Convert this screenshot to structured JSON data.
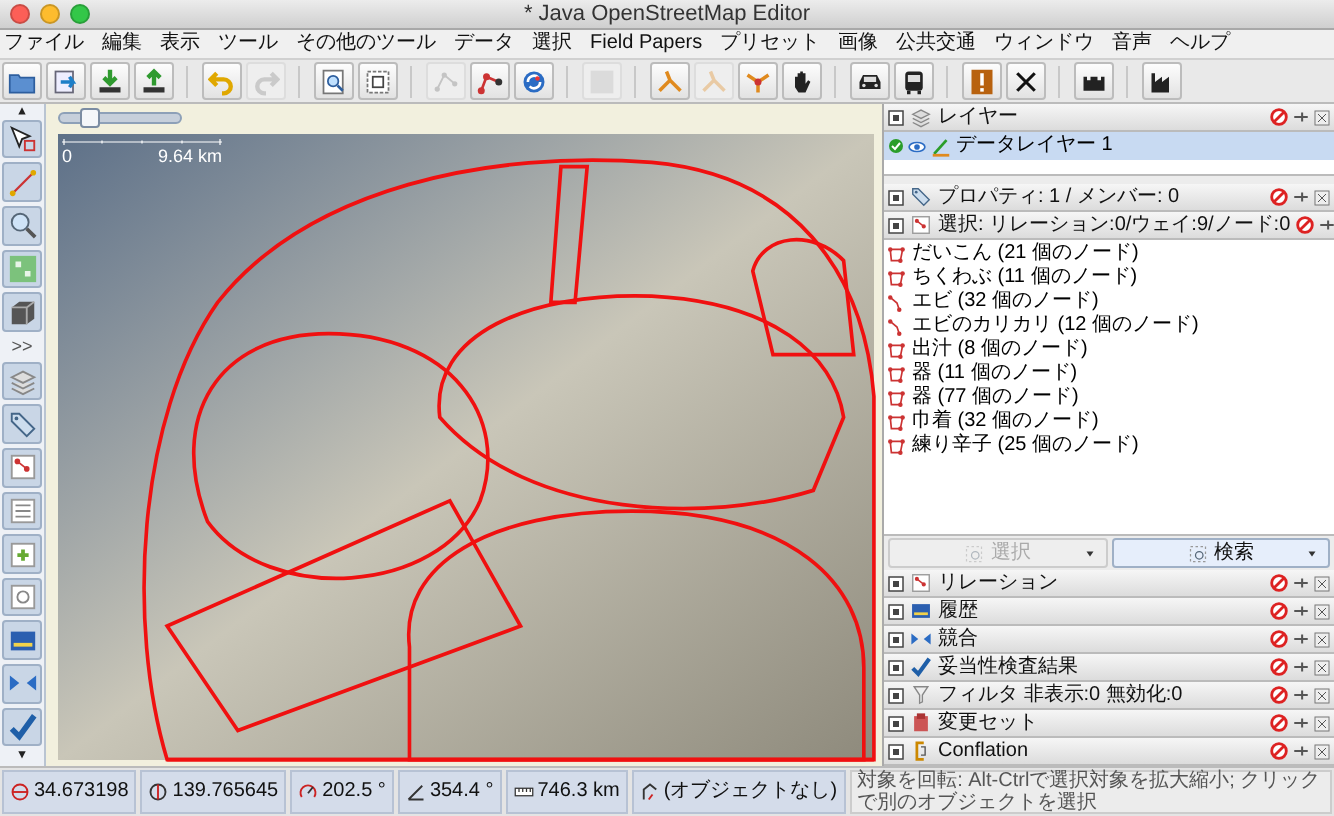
{
  "window": {
    "title": "* Java OpenStreetMap Editor"
  },
  "menu": [
    "ファイル",
    "編集",
    "表示",
    "ツール",
    "その他のツール",
    "データ",
    "選択",
    "Field Papers",
    "プリセット",
    "画像",
    "公共交通",
    "ウィンドウ",
    "音声",
    "ヘルプ"
  ],
  "toolbar_groups": [
    {
      "buttons": [
        {
          "kind": "folder",
          "disabled": false
        },
        {
          "kind": "open-location",
          "disabled": false
        },
        {
          "kind": "download",
          "disabled": false
        },
        {
          "kind": "upload",
          "disabled": false
        }
      ]
    },
    {
      "buttons": [
        {
          "kind": "undo",
          "disabled": false
        },
        {
          "kind": "redo",
          "disabled": true
        }
      ]
    },
    {
      "buttons": [
        {
          "kind": "magnifier",
          "disabled": false
        },
        {
          "kind": "frame",
          "disabled": false
        }
      ]
    },
    {
      "buttons": [
        {
          "kind": "nodes",
          "disabled": true
        },
        {
          "kind": "way-tool",
          "disabled": false
        },
        {
          "kind": "refresh",
          "disabled": false
        }
      ]
    },
    {
      "buttons": [
        {
          "kind": "square",
          "disabled": true
        }
      ]
    },
    {
      "buttons": [
        {
          "kind": "split",
          "disabled": false
        },
        {
          "kind": "split",
          "disabled": true
        },
        {
          "kind": "star",
          "disabled": false
        },
        {
          "kind": "hand",
          "disabled": false
        }
      ]
    },
    {
      "buttons": [
        {
          "kind": "car",
          "disabled": false
        },
        {
          "kind": "bus",
          "disabled": false
        }
      ]
    },
    {
      "buttons": [
        {
          "kind": "warning",
          "disabled": false
        },
        {
          "kind": "cross",
          "disabled": false
        }
      ]
    },
    {
      "buttons": [
        {
          "kind": "castle",
          "disabled": false
        }
      ]
    },
    {
      "buttons": [
        {
          "kind": "factory",
          "disabled": false
        }
      ]
    }
  ],
  "left_toolbar": {
    "tools": [
      {
        "kind": "select"
      },
      {
        "kind": "draw"
      },
      {
        "kind": "zoom"
      },
      {
        "kind": "area"
      },
      {
        "kind": "box"
      }
    ],
    "more": ">>",
    "panels": [
      {
        "kind": "layers"
      },
      {
        "kind": "tag"
      },
      {
        "kind": "relation"
      },
      {
        "kind": "selection"
      },
      {
        "kind": "plus"
      },
      {
        "kind": "members"
      },
      {
        "kind": "history"
      },
      {
        "kind": "conflict"
      },
      {
        "kind": "validation"
      }
    ]
  },
  "map": {
    "zoom_slider": {
      "level": 0.25
    },
    "scale": {
      "start": "0",
      "end": "9.64 km"
    }
  },
  "layers_dialog": {
    "title": "レイヤー",
    "layers": [
      {
        "name": "データレイヤー 1",
        "selected": true,
        "active": true,
        "visible": true
      }
    ]
  },
  "properties_dialog": {
    "title": "プロパティ: 1 / メンバー: 0"
  },
  "selection_dialog": {
    "title": "選択: リレーション:0/ウェイ:9/ノード:0",
    "items": [
      {
        "text": "だいこん (21 個のノード)",
        "kind": "closed"
      },
      {
        "text": "ちくわぶ (11 個のノード)",
        "kind": "closed"
      },
      {
        "text": "エビ (32 個のノード)",
        "kind": "open"
      },
      {
        "text": "エビのカリカリ (12 個のノード)",
        "kind": "open"
      },
      {
        "text": "出汁 (8 個のノード)",
        "kind": "closed"
      },
      {
        "text": "器 (11 個のノード)",
        "kind": "closed"
      },
      {
        "text": "器 (77 個のノード)",
        "kind": "closed"
      },
      {
        "text": "巾着 (32 個のノード)",
        "kind": "closed"
      },
      {
        "text": "練り辛子 (25 個のノード)",
        "kind": "closed"
      }
    ],
    "buttons": [
      {
        "label": "選択",
        "disabled": true
      },
      {
        "label": "検索",
        "disabled": false
      }
    ]
  },
  "dialogs": [
    {
      "title": "リレーション",
      "kind": "relation"
    },
    {
      "title": "履歴",
      "kind": "history"
    },
    {
      "title": "競合",
      "kind": "conflict"
    },
    {
      "title": "妥当性検査結果",
      "kind": "validation"
    },
    {
      "title": "フィルタ 非表示:0 無効化:0",
      "kind": "filter"
    },
    {
      "title": "変更セット",
      "kind": "changeset"
    },
    {
      "title": "Conflation",
      "kind": "conflation"
    }
  ],
  "status_bar": {
    "latitude": "34.673198",
    "longitude": "139.765645",
    "heading": "202.5 °",
    "angle": "354.4 °",
    "distance": "746.3 km",
    "object": "(オブジェクトなし)",
    "message": "対象を回転: Alt-Ctrlで選択対象を拡大縮小; クリックで別のオブジェクトを選択"
  }
}
